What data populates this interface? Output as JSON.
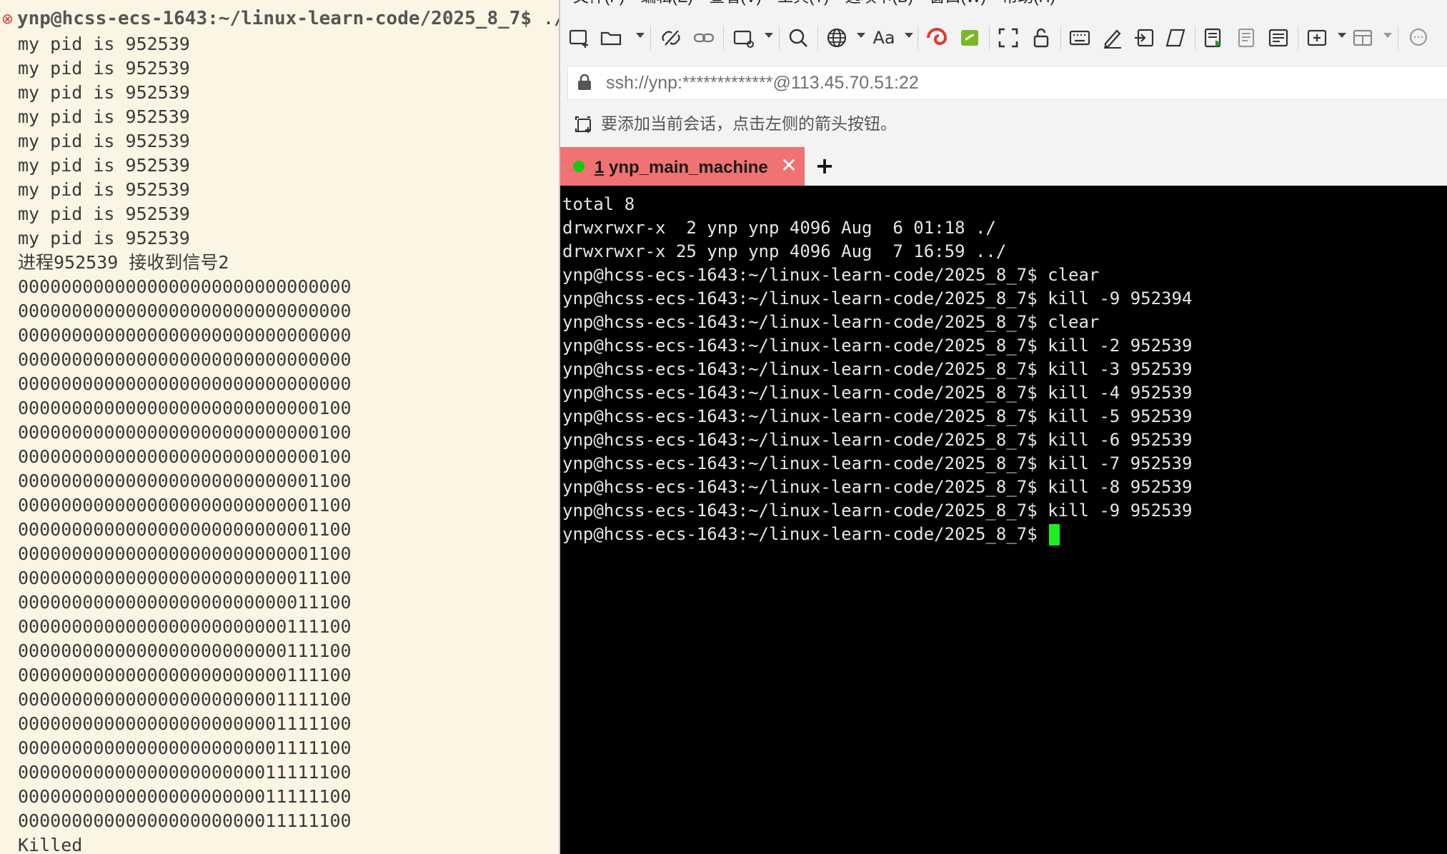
{
  "left_terminal": {
    "prompt": "ynp@hcss-ecs-1643:~/linux-learn-code/2025_8_7$",
    "prompt_tail": " ./Te",
    "lines": [
      "my pid is 952539",
      "my pid is 952539",
      "my pid is 952539",
      "my pid is 952539",
      "my pid is 952539",
      "my pid is 952539",
      "my pid is 952539",
      "my pid is 952539",
      "my pid is 952539",
      "进程952539 接收到信号2",
      "0000000000000000000000000000000",
      "0000000000000000000000000000000",
      "0000000000000000000000000000000",
      "0000000000000000000000000000000",
      "0000000000000000000000000000000",
      "0000000000000000000000000000100",
      "0000000000000000000000000000100",
      "0000000000000000000000000000100",
      "0000000000000000000000000001100",
      "0000000000000000000000000001100",
      "0000000000000000000000000001100",
      "0000000000000000000000000001100",
      "0000000000000000000000000011100",
      "0000000000000000000000000011100",
      "0000000000000000000000000111100",
      "0000000000000000000000000111100",
      "0000000000000000000000000111100",
      "0000000000000000000000001111100",
      "0000000000000000000000001111100",
      "0000000000000000000000001111100",
      "0000000000000000000000011111100",
      "0000000000000000000000011111100",
      "0000000000000000000000011111100",
      "Killed"
    ]
  },
  "menu": [
    "文件(F)",
    "编辑(E)",
    "查看(V)",
    "工具(T)",
    "选项卡(B)",
    "窗口(W)",
    "帮助(H)"
  ],
  "toolbar": {
    "icons": [
      "new-session-icon",
      "open-folder-icon",
      "disconnect-icon",
      "link-icon",
      "new-window-icon",
      "search-icon",
      "globe-icon",
      "font-icon",
      "xftp-icon",
      "xshell-green-icon",
      "fullscreen-icon",
      "lock-icon",
      "keyboard-icon",
      "pen-icon",
      "send-icon",
      "script-icon",
      "transfer-icon",
      "log-icon",
      "compose-icon",
      "new-tab-icon",
      "layout-icon",
      "chat-icon"
    ],
    "font_label": "Aa"
  },
  "address": {
    "text": "ssh://ynp:*************@113.45.70.51:22"
  },
  "hint": {
    "text": "要添加当前会话，点击左侧的箭头按钮。"
  },
  "tabs": {
    "active": {
      "number": "1",
      "name": " ynp_main_machine",
      "status_color": "#13c713"
    },
    "close_symbol": "✕",
    "add_symbol": "+"
  },
  "right_terminal": {
    "lines": [
      "total 8",
      "drwxrwxr-x  2 ynp ynp 4096 Aug  6 01:18 ./",
      "drwxrwxr-x 25 ynp ynp 4096 Aug  7 16:59 ../",
      "ynp@hcss-ecs-1643:~/linux-learn-code/2025_8_7$ clear",
      "ynp@hcss-ecs-1643:~/linux-learn-code/2025_8_7$ kill -9 952394",
      "ynp@hcss-ecs-1643:~/linux-learn-code/2025_8_7$ clear",
      "ynp@hcss-ecs-1643:~/linux-learn-code/2025_8_7$ kill -2 952539",
      "ynp@hcss-ecs-1643:~/linux-learn-code/2025_8_7$ kill -3 952539",
      "ynp@hcss-ecs-1643:~/linux-learn-code/2025_8_7$ kill -4 952539",
      "ynp@hcss-ecs-1643:~/linux-learn-code/2025_8_7$ kill -5 952539",
      "ynp@hcss-ecs-1643:~/linux-learn-code/2025_8_7$ kill -6 952539",
      "ynp@hcss-ecs-1643:~/linux-learn-code/2025_8_7$ kill -7 952539",
      "ynp@hcss-ecs-1643:~/linux-learn-code/2025_8_7$ kill -8 952539",
      "ynp@hcss-ecs-1643:~/linux-learn-code/2025_8_7$ kill -9 952539"
    ],
    "current_prompt": "ynp@hcss-ecs-1643:~/linux-learn-code/2025_8_7$ ",
    "cursor_color": "#1cf01c"
  }
}
